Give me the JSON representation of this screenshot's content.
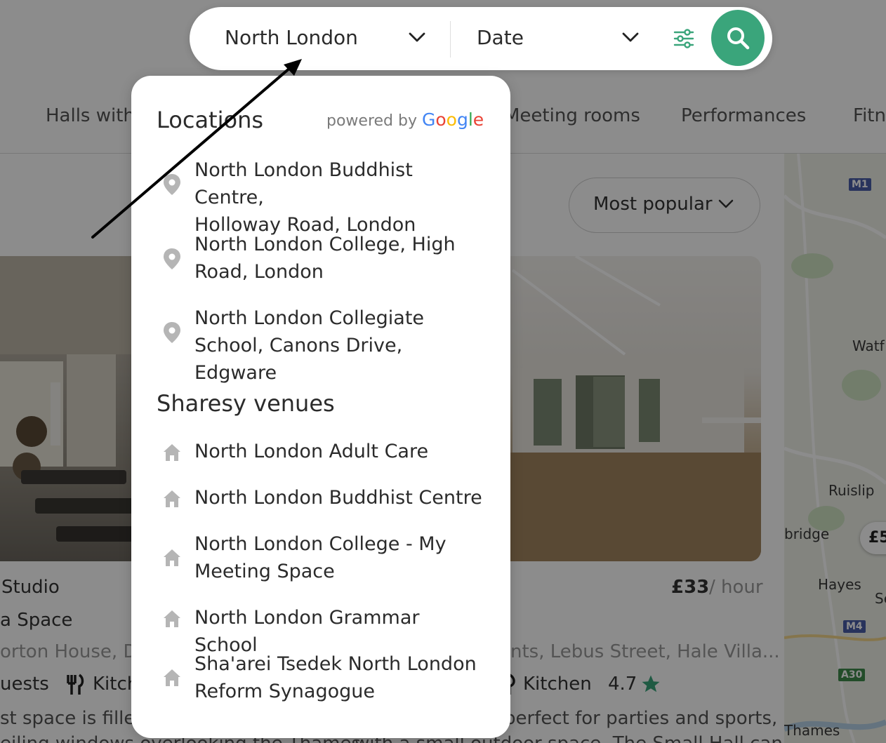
{
  "search": {
    "location": "North London",
    "date": "Date"
  },
  "categories": [
    "Halls with",
    "Meeting rooms",
    "Performances",
    "Fitn"
  ],
  "sort": {
    "label": "Most popular"
  },
  "cards": {
    "left": {
      "title_line1": "Studio",
      "title_line2": "a Space",
      "address": "orton House, Du",
      "guests": "uests",
      "amenity": "Kitch",
      "desc": "st space is filled",
      "desc2": "eiling windows overlooking the Thames"
    },
    "right": {
      "price": "£33",
      "price_unit": "/ hour",
      "address": "nts, Lebus Street, Hale Villa...",
      "amenity": "Kitchen",
      "rating": "4.7",
      "desc": "perfect for parties and sports,",
      "desc2": "with a small outdoor space. The Small Hall can be"
    }
  },
  "map": {
    "labels": [
      "Watf",
      "Ruislip",
      "bridge",
      "Hayes",
      "Thames",
      "Se"
    ],
    "roads": [
      "M1",
      "M4",
      "A30"
    ],
    "price_pin": "£5"
  },
  "dropdown": {
    "locations_heading": "Locations",
    "powered_by": "powered by",
    "google": [
      "G",
      "o",
      "o",
      "g",
      "l",
      "e"
    ],
    "locations": [
      {
        "line1": "North London Buddhist Centre,",
        "line2": "Holloway Road, London"
      },
      {
        "line1": "North London College, High",
        "line2": "Road, London"
      },
      {
        "line1": "North London Collegiate",
        "line2": "School, Canons Drive, Edgware"
      }
    ],
    "venues_heading": "Sharesy venues",
    "venues": [
      {
        "line1": "North London Adult Care",
        "line2": ""
      },
      {
        "line1": "North London Buddhist Centre",
        "line2": ""
      },
      {
        "line1": "North London College - My",
        "line2": "Meeting Space"
      },
      {
        "line1": "North London Grammar School",
        "line2": ""
      },
      {
        "line1": "Sha'arei Tsedek North London",
        "line2": "Reform Synagogue"
      }
    ]
  },
  "colors": {
    "accent": "#3aa57b",
    "overlay": "rgba(0,0,0,0.45)",
    "icon_grey": "#b5b5b5"
  }
}
